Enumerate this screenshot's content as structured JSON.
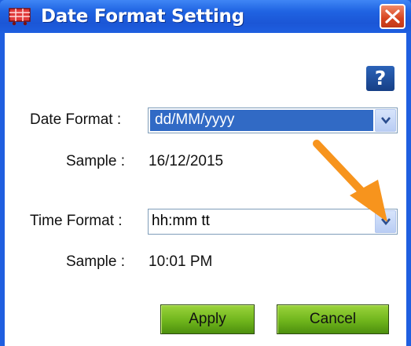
{
  "window": {
    "title": "Date Format Setting"
  },
  "help": {
    "label": "?"
  },
  "date_format": {
    "label": "Date Format :",
    "value": "dd/MM/yyyy",
    "sample_label": "Sample :",
    "sample_value": "16/12/2015"
  },
  "time_format": {
    "label": "Time Format :",
    "value": "hh:mm tt",
    "sample_label": "Sample :",
    "sample_value": "10:01 PM"
  },
  "buttons": {
    "apply": "Apply",
    "cancel": "Cancel"
  },
  "colors": {
    "titlebar": "#1f5fe0",
    "selection": "#316ac5",
    "button_green": "#6fb51c",
    "annotation_arrow": "#f7941d"
  },
  "icons": {
    "app": "shopping-cart-icon",
    "close": "close-icon",
    "help": "help-icon",
    "dropdown": "chevron-down-icon",
    "annotation": "arrow-annotation-icon"
  }
}
